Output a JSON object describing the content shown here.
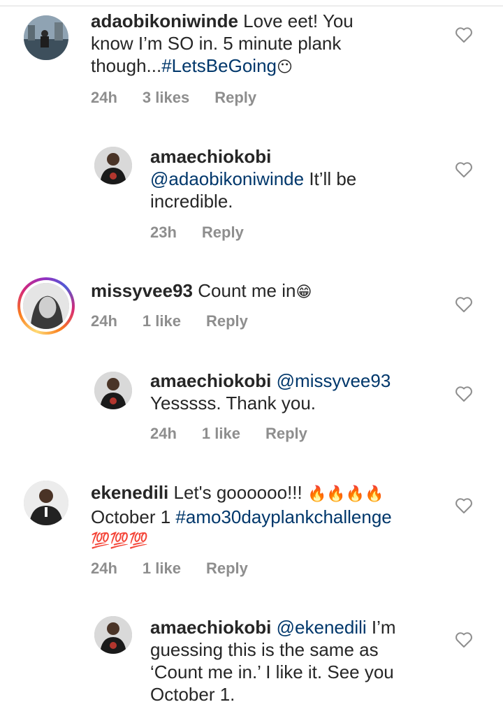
{
  "comments": [
    {
      "username": "adaobikoniwinde",
      "line1": "Love eet! You",
      "line2": "know I’m SO in. 5 minute plank",
      "line3_prefix": "though...",
      "line3_hashtag": "#LetsBeGoing",
      "emoji": "😶",
      "time": "24h",
      "likes": "3 likes",
      "reply": "Reply"
    },
    {
      "username": "amaechiokobi",
      "mention": "@adaobikoniwinde",
      "line1_suffix": " It’ll be",
      "line2": "incredible.",
      "time": "23h",
      "reply": "Reply"
    },
    {
      "username": "missyvee93",
      "text": "Count me in",
      "emoji": "😁",
      "time": "24h",
      "likes": "1 like",
      "reply": "Reply"
    },
    {
      "username": "amaechiokobi",
      "mention": "@missyvee93",
      "line2": "Yesssss. Thank you.",
      "time": "24h",
      "likes": "1 like",
      "reply": "Reply"
    },
    {
      "username": "ekenedili",
      "line1": "Let's goooooo!!!",
      "fire_emojis": "🔥🔥🔥🔥",
      "line2_prefix": "October 1 ",
      "hashtag": "#amo30dayplankchallenge",
      "hundred_emojis": "💯💯💯",
      "time": "24h",
      "likes": "1 like",
      "reply": "Reply"
    },
    {
      "username": "amaechiokobi",
      "mention": "@ekenedili",
      "line1_suffix": " I’m",
      "line2": "guessing this is the same as",
      "line3": "‘Count me in.’ I like it. See you",
      "line4": "October 1."
    }
  ],
  "icons": {
    "like": "heart-outline-icon"
  },
  "colors": {
    "text": "#262626",
    "link": "#00376b",
    "meta": "#8e8e8e",
    "heart": "#8e8e8e"
  }
}
